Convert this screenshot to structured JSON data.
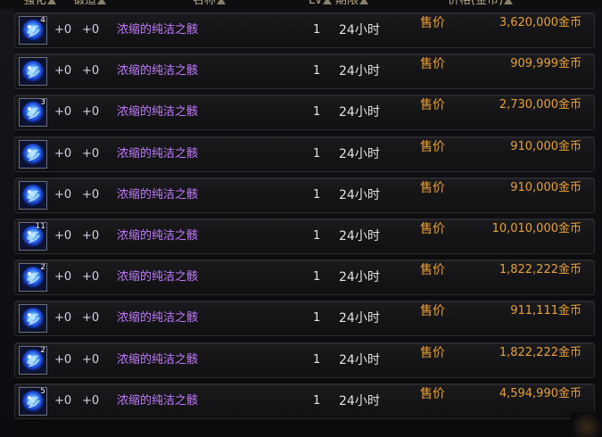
{
  "header": {
    "col_strengthen": "强化",
    "col_forge": "锻造",
    "col_name": "名称",
    "col_level": "Lv",
    "col_period": "期限",
    "col_price": "价格(金币)"
  },
  "rows": [
    {
      "stack": "4",
      "strengthen": "+0",
      "forge": "+0",
      "name": "浓缩的纯洁之骸",
      "level": "1",
      "period": "24小时",
      "price_label": "售价",
      "price": "3,620,000金币"
    },
    {
      "stack": "",
      "strengthen": "+0",
      "forge": "+0",
      "name": "浓缩的纯洁之骸",
      "level": "1",
      "period": "24小时",
      "price_label": "售价",
      "price": "909,999金币"
    },
    {
      "stack": "3",
      "strengthen": "+0",
      "forge": "+0",
      "name": "浓缩的纯洁之骸",
      "level": "1",
      "period": "24小时",
      "price_label": "售价",
      "price": "2,730,000金币"
    },
    {
      "stack": "",
      "strengthen": "+0",
      "forge": "+0",
      "name": "浓缩的纯洁之骸",
      "level": "1",
      "period": "24小时",
      "price_label": "售价",
      "price": "910,000金币"
    },
    {
      "stack": "",
      "strengthen": "+0",
      "forge": "+0",
      "name": "浓缩的纯洁之骸",
      "level": "1",
      "period": "24小时",
      "price_label": "售价",
      "price": "910,000金币"
    },
    {
      "stack": "11",
      "strengthen": "+0",
      "forge": "+0",
      "name": "浓缩的纯洁之骸",
      "level": "1",
      "period": "24小时",
      "price_label": "售价",
      "price": "10,010,000金币"
    },
    {
      "stack": "2",
      "strengthen": "+0",
      "forge": "+0",
      "name": "浓缩的纯洁之骸",
      "level": "1",
      "period": "24小时",
      "price_label": "售价",
      "price": "1,822,222金币"
    },
    {
      "stack": "",
      "strengthen": "+0",
      "forge": "+0",
      "name": "浓缩的纯洁之骸",
      "level": "1",
      "period": "24小时",
      "price_label": "售价",
      "price": "911,111金币"
    },
    {
      "stack": "2",
      "strengthen": "+0",
      "forge": "+0",
      "name": "浓缩的纯洁之骸",
      "level": "1",
      "period": "24小时",
      "price_label": "售价",
      "price": "1,822,222金币"
    },
    {
      "stack": "5",
      "strengthen": "+0",
      "forge": "+0",
      "name": "浓缩的纯洁之骸",
      "level": "1",
      "period": "24小时",
      "price_label": "售价",
      "price": "4,594,990金币"
    }
  ],
  "icons": {
    "item": "blue-crystal-orb-icon",
    "sort": "sort-triangle-icon"
  },
  "colors": {
    "item_name": "#c27bff",
    "price": "#e8a03a",
    "header": "#b9a98a"
  }
}
